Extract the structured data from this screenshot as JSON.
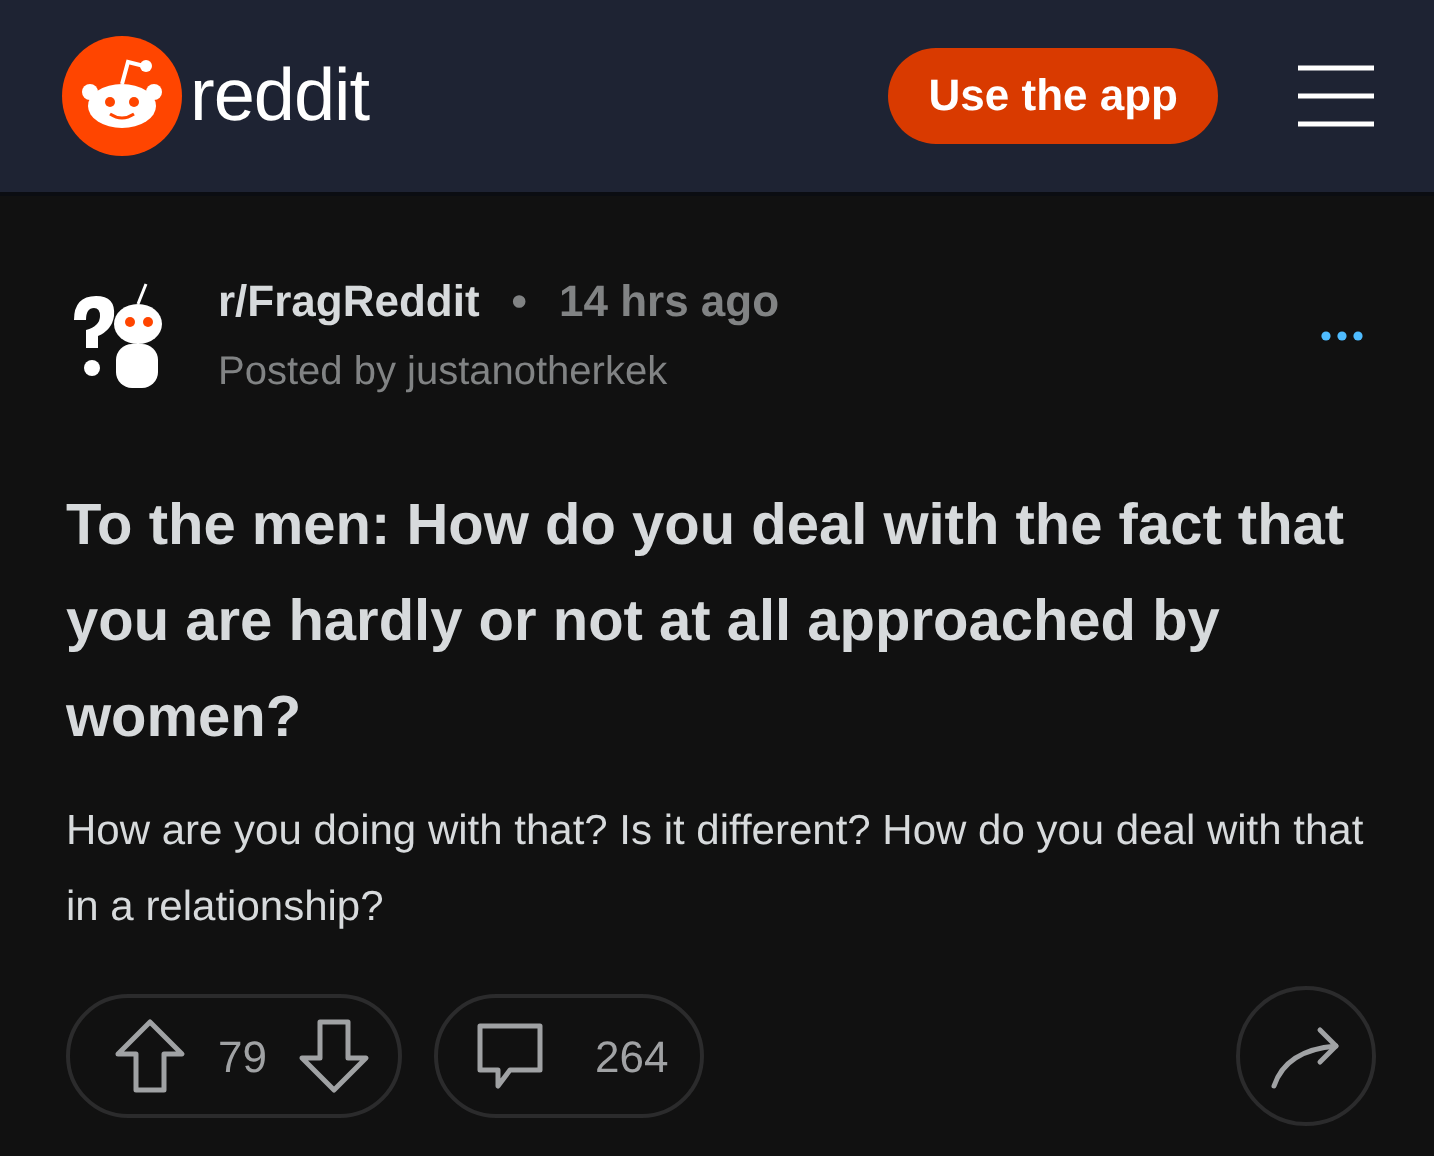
{
  "header": {
    "logo_text": "reddit",
    "app_button": "Use the app"
  },
  "post": {
    "subreddit": "r/FragReddit",
    "separator": "•",
    "time": "14 hrs ago",
    "author_line": "Posted by justanotherkek",
    "title": "To the men: How do you deal with the fact that you are hardly or not at all approached by women?",
    "body": "How are you doing with that? Is it different? How do you deal with that in a relationship?",
    "votes": "79",
    "comments": "264"
  }
}
